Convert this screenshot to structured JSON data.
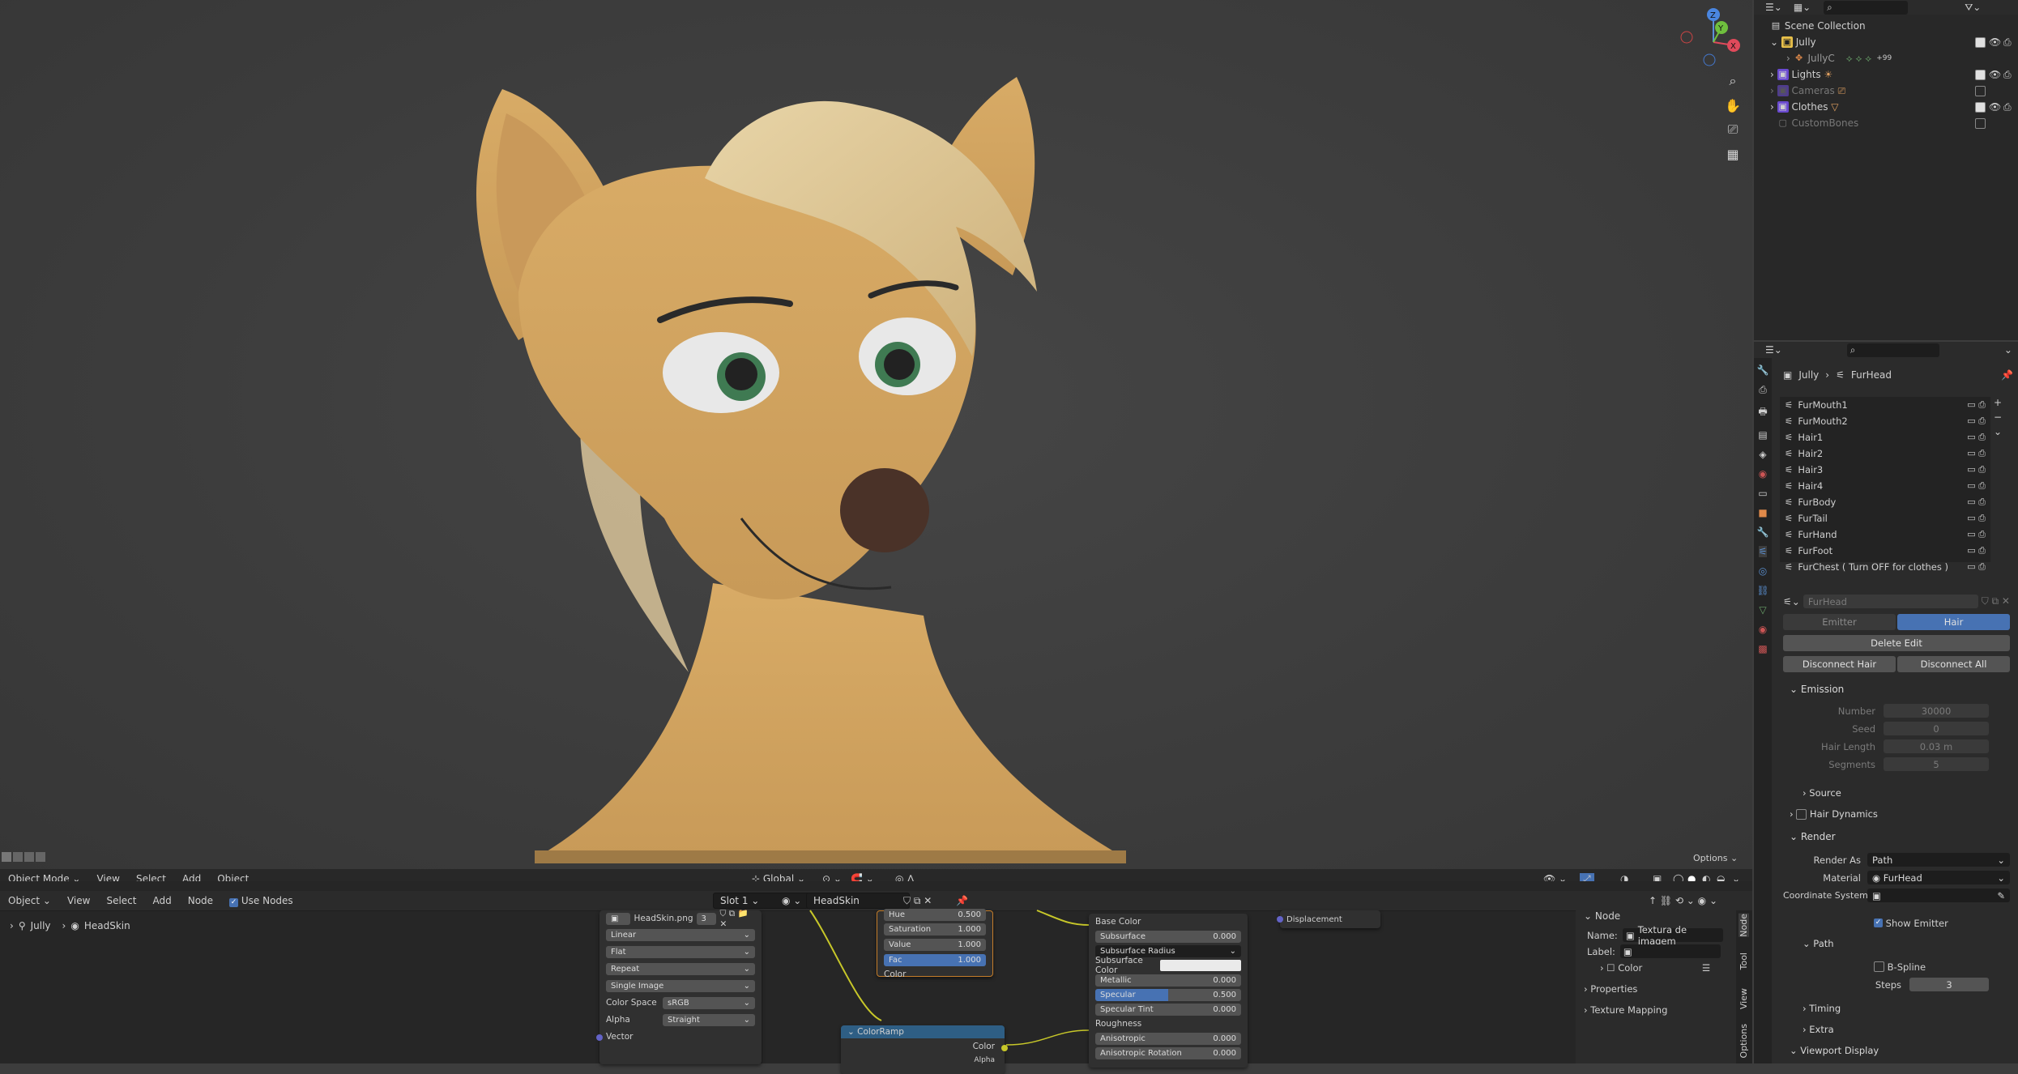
{
  "viewport": {
    "header": {
      "mode": "Object Mode",
      "menus": [
        "View",
        "Select",
        "Add",
        "Object"
      ],
      "transform_orientation": "Global",
      "options_label": "Options"
    },
    "gizmo": {
      "z": "Z",
      "y": "Y",
      "x": "X"
    }
  },
  "node_editor": {
    "header": {
      "object_label": "Object",
      "menus": [
        "View",
        "Select",
        "Add",
        "Node"
      ],
      "use_nodes_label": "Use Nodes",
      "slot": "Slot 1",
      "material": "HeadSkin"
    },
    "breadcrumb": {
      "object": "Jully",
      "material": "HeadSkin"
    },
    "image_node": {
      "image_name": "HeadSkin.png",
      "users": "3",
      "interpolation": "Linear",
      "projection": "Flat",
      "extension": "Repeat",
      "source": "Single Image",
      "color_space_label": "Color Space",
      "color_space": "sRGB",
      "alpha_label": "Alpha",
      "alpha": "Straight",
      "vector_label": "Vector"
    },
    "hsv_node": {
      "hue_label": "Hue",
      "hue": "0.500",
      "saturation_label": "Saturation",
      "saturation": "1.000",
      "value_label": "Value",
      "value": "1.000",
      "fac_label": "Fac",
      "fac": "1.000",
      "color_label": "Color"
    },
    "colorramp_node": {
      "title": "ColorRamp",
      "color_label": "Color",
      "alpha_label": "Alpha"
    },
    "bsdf_node": {
      "base_color": "Base Color",
      "subsurface": "Subsurface",
      "subsurface_val": "0.000",
      "subsurface_radius": "Subsurface Radius",
      "subsurface_color": "Subsurface Color",
      "metallic": "Metallic",
      "metallic_val": "0.000",
      "specular": "Specular",
      "specular_val": "0.500",
      "specular_tint": "Specular Tint",
      "specular_tint_val": "0.000",
      "roughness": "Roughness",
      "anisotropic": "Anisotropic",
      "anisotropic_val": "0.000",
      "anisotropic_rotation": "Anisotropic Rotation",
      "anisotropic_rotation_val": "0.000"
    },
    "output_node": {
      "displacement": "Displacement"
    },
    "sidebar": {
      "section": "Node",
      "name_label": "Name:",
      "name_value": "Textura de imagem",
      "label_label": "Label:",
      "color_label": "Color",
      "properties": "Properties",
      "texture_mapping": "Texture Mapping",
      "tabs": [
        "Node",
        "Tool",
        "View",
        "Options"
      ]
    }
  },
  "outliner": {
    "root": "Scene Collection",
    "items": [
      {
        "label": "Jully",
        "indent": 1
      },
      {
        "label": "JullyC",
        "indent": 2
      },
      {
        "label": "Lights",
        "indent": 1
      },
      {
        "label": "Cameras",
        "indent": 1
      },
      {
        "label": "Clothes",
        "indent": 1
      },
      {
        "label": "CustomBones",
        "indent": 1
      }
    ],
    "badge": "+99"
  },
  "properties": {
    "breadcrumb": {
      "object": "Jully",
      "system": "FurHead"
    },
    "particle_systems": [
      "FurMouth1",
      "FurMouth2",
      "Hair1",
      "Hair2",
      "Hair3",
      "Hair4",
      "FurBody",
      "FurTail",
      "FurHand",
      "FurFoot",
      "FurChest ( Turn OFF for clothes )"
    ],
    "settings_name": "FurHead",
    "type_tabs": [
      "Emitter",
      "Hair"
    ],
    "delete_edit": "Delete Edit",
    "disconnect_hair": "Disconnect Hair",
    "disconnect_all": "Disconnect All",
    "emission": {
      "title": "Emission",
      "number_label": "Number",
      "number": "30000",
      "seed_label": "Seed",
      "seed": "0",
      "hair_length_label": "Hair Length",
      "hair_length": "0.03 m",
      "segments_label": "Segments",
      "segments": "5",
      "source": "Source"
    },
    "hair_dynamics": "Hair Dynamics",
    "render": {
      "title": "Render",
      "render_as_label": "Render As",
      "render_as": "Path",
      "material_label": "Material",
      "material": "FurHead",
      "coord_label": "Coordinate System",
      "show_emitter": "Show Emitter",
      "path": "Path",
      "bspline": "B-Spline",
      "steps_label": "Steps",
      "steps": "3",
      "timing": "Timing",
      "extra": "Extra",
      "viewport_display": "Viewport Display"
    }
  },
  "colors": {
    "accent": "#4772b3",
    "panel": "#2b2b2b",
    "skin": "#d6a664"
  }
}
